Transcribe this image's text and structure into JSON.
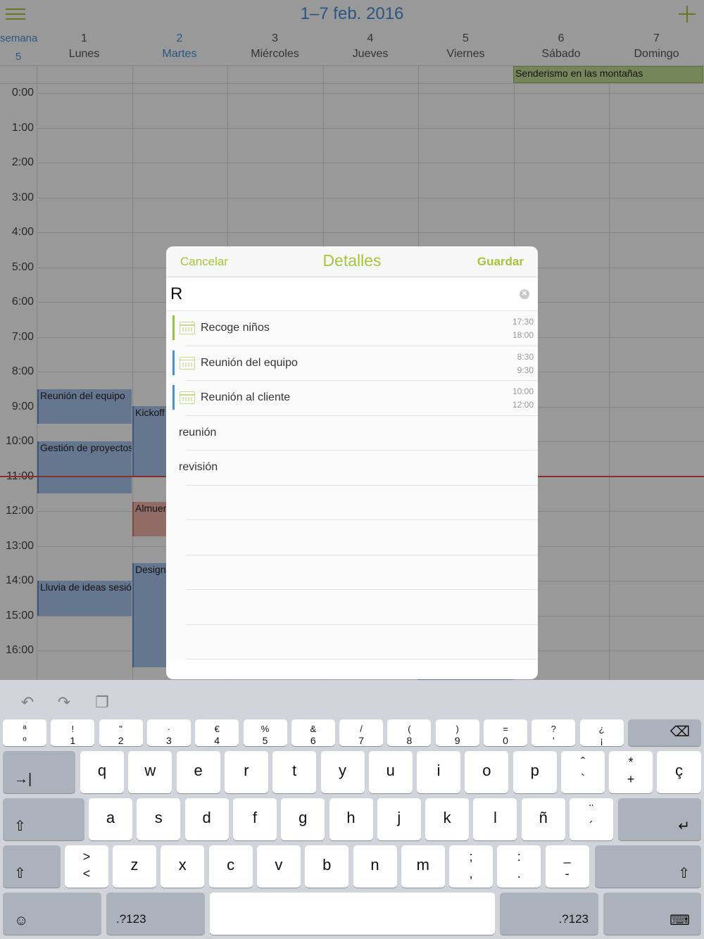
{
  "header": {
    "title": "1–7 feb. 2016"
  },
  "week": {
    "label": "semana",
    "number": "5"
  },
  "days": [
    {
      "num": "1",
      "name": "Lunes",
      "today": false
    },
    {
      "num": "2",
      "name": "Martes",
      "today": true
    },
    {
      "num": "3",
      "name": "Miércoles",
      "today": false
    },
    {
      "num": "4",
      "name": "Jueves",
      "today": false
    },
    {
      "num": "5",
      "name": "Viernes",
      "today": false
    },
    {
      "num": "6",
      "name": "Sábado",
      "today": false
    },
    {
      "num": "7",
      "name": "Domingo",
      "today": false
    }
  ],
  "hours": [
    "0:00",
    "1:00",
    "2:00",
    "3:00",
    "4:00",
    "5:00",
    "6:00",
    "7:00",
    "8:00",
    "9:00",
    "10:00",
    "11:00",
    "12:00",
    "13:00",
    "14:00",
    "15:00",
    "16:00"
  ],
  "events": {
    "allday": "Senderismo en las montañas",
    "team": "Reunión del equipo",
    "project": "Gestión de proyectos",
    "brainstorm": "Lluvia de ideas sesión",
    "kickoff": "Kickoff I",
    "lunch": "Almuerz",
    "design": "Design V"
  },
  "colors": {
    "accent": "#a8c43a",
    "blue": "#4a90d9",
    "now": "#e05050"
  },
  "modal": {
    "cancel": "Cancelar",
    "title": "Detalles",
    "save": "Guardar",
    "query": "R",
    "suggestions": [
      {
        "label": "Recoge niños",
        "start": "17:30",
        "end": "18:00",
        "color": "#9bc14b"
      },
      {
        "label": "Reunión del equipo",
        "start": "8:30",
        "end": "9:30",
        "color": "#4a90d9"
      },
      {
        "label": "Reunión al cliente",
        "start": "10:00",
        "end": "12:00",
        "color": "#4a90d9"
      }
    ],
    "words": [
      "reunión",
      "revisión"
    ]
  },
  "keyboard": {
    "toolbar": [
      "undo-icon",
      "redo-icon",
      "paste-icon"
    ],
    "row1": [
      [
        "ª",
        "º"
      ],
      [
        "!",
        "1"
      ],
      [
        "\"",
        "2"
      ],
      [
        "·",
        "3"
      ],
      [
        "€",
        "4"
      ],
      [
        "%",
        "5"
      ],
      [
        "&",
        "6"
      ],
      [
        "/",
        "7"
      ],
      [
        "(",
        "8"
      ],
      [
        ")",
        "9"
      ],
      [
        "=",
        "0"
      ],
      [
        "?",
        "'"
      ],
      [
        "¿",
        "¡"
      ]
    ],
    "row2": [
      "q",
      "w",
      "e",
      "r",
      "t",
      "y",
      "u",
      "i",
      "o",
      "p"
    ],
    "row2_extra": [
      [
        "ˆ",
        "`"
      ],
      [
        "*",
        "+"
      ],
      [
        "ç",
        ""
      ]
    ],
    "row3": [
      "a",
      "s",
      "d",
      "f",
      "g",
      "h",
      "j",
      "k",
      "l",
      "ñ"
    ],
    "row3_extra": [
      [
        "¨",
        "´"
      ]
    ],
    "row4_first": [
      ">",
      "<"
    ],
    "row4": [
      "z",
      "x",
      "c",
      "v",
      "b",
      "n",
      "m"
    ],
    "row4_extra": [
      [
        ";",
        ","
      ],
      [
        ":",
        "."
      ],
      [
        "_",
        "-"
      ]
    ],
    "numbers_label": ".?123",
    "tab": "→|",
    "shift": "⇧",
    "backspace": "⌫",
    "return": "↵",
    "emoji": "☺",
    "hide": "⌨"
  }
}
